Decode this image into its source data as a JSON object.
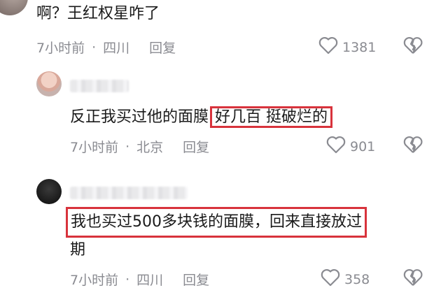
{
  "comments": [
    {
      "text": "啊？王红权星咋了",
      "time": "7小时前",
      "location": "四川",
      "reply_label": "回复",
      "likes": "1381"
    },
    {
      "text_part1": "反正我买过他的面膜",
      "text_highlight": "好几百 挺破烂的",
      "time": "7小时前",
      "location": "北京",
      "reply_label": "回复",
      "likes": "901"
    },
    {
      "text_highlight_line1": "我也买过500多块钱的面膜，回来直接放过",
      "text_line2": "期",
      "time": "7小时前",
      "location": "四川",
      "reply_label": "回复",
      "likes": "358"
    }
  ],
  "icons": {
    "like": "heart-outline-icon",
    "dislike": "broken-heart-icon"
  },
  "colors": {
    "highlight_border": "#d8333c",
    "meta_text": "#8a8b91",
    "body_text": "#1a1a1a"
  }
}
